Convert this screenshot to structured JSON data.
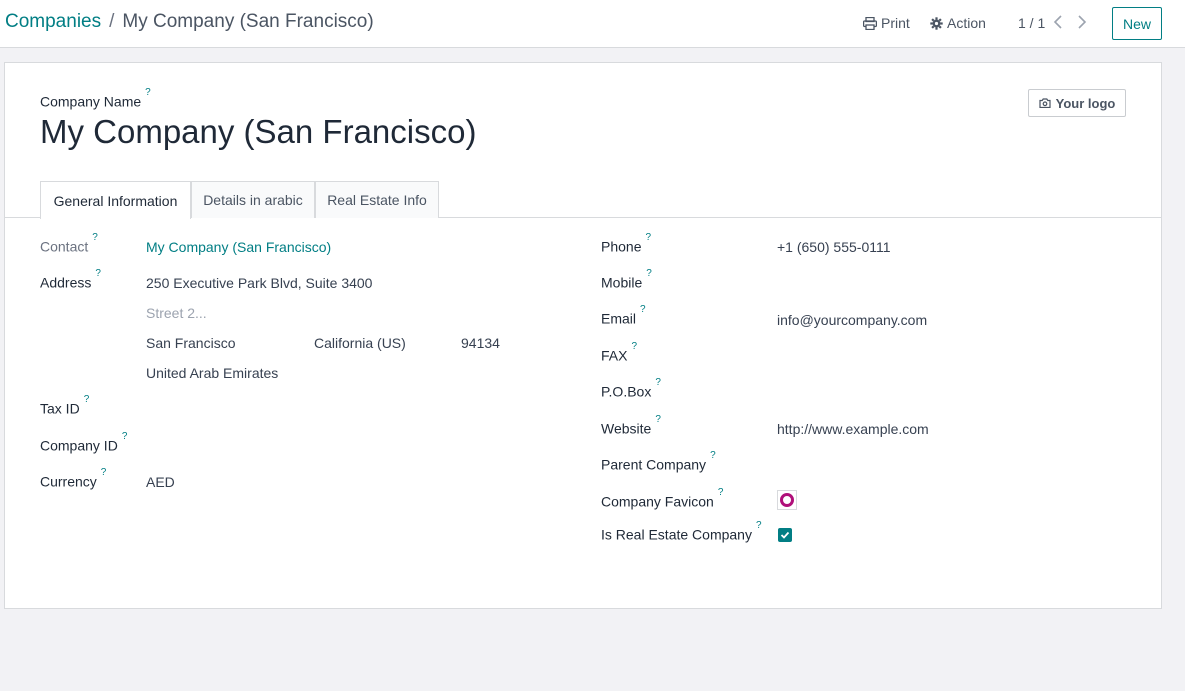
{
  "breadcrumb": {
    "parent": "Companies",
    "separator": "/",
    "current": "My Company (San Francisco)"
  },
  "toolbar": {
    "print_label": "Print",
    "action_label": "Action",
    "pager": "1 / 1",
    "new_label": "New"
  },
  "form": {
    "name_label": "Company Name",
    "name_value": "My Company (San Francisco)",
    "logo_button": "Your logo",
    "help_mark": "?",
    "tabs": [
      {
        "label": "General Information",
        "active": true
      },
      {
        "label": "Details in arabic",
        "active": false
      },
      {
        "label": "Real Estate Info",
        "active": false
      }
    ],
    "left": {
      "contact_label": "Contact",
      "contact_value": "My Company (San Francisco)",
      "address_label": "Address",
      "street": "250 Executive Park Blvd, Suite 3400",
      "street2_placeholder": "Street 2...",
      "city": "San Francisco",
      "state": "California (US)",
      "zip": "94134",
      "country": "United Arab Emirates",
      "tax_id_label": "Tax ID",
      "company_id_label": "Company ID",
      "currency_label": "Currency",
      "currency_value": "AED"
    },
    "right": {
      "phone_label": "Phone",
      "phone_value": "+1 (650) 555-0111",
      "mobile_label": "Mobile",
      "email_label": "Email",
      "email_value": "info@yourcompany.com",
      "fax_label": "FAX",
      "pobox_label": "P.O.Box",
      "website_label": "Website",
      "website_value": "http://www.example.com",
      "parent_label": "Parent Company",
      "favicon_label": "Company Favicon",
      "real_estate_label": "Is Real Estate Company",
      "real_estate_checked": true
    }
  },
  "colors": {
    "accent": "#017e84",
    "favicon": "#b0107a"
  }
}
